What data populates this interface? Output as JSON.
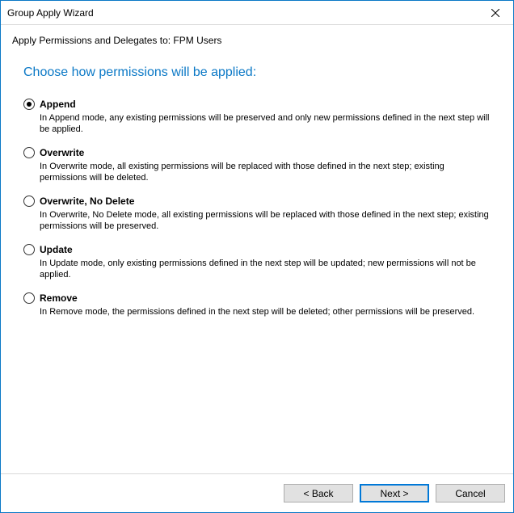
{
  "window": {
    "title": "Group Apply Wizard"
  },
  "subtitle": "Apply Permissions and Delegates to: FPM Users",
  "heading": "Choose how permissions will be applied:",
  "options": [
    {
      "label": "Append",
      "description": "In Append mode, any existing permissions will be preserved and only new permissions defined in the next step will be applied.",
      "checked": true
    },
    {
      "label": "Overwrite",
      "description": "In Overwrite mode, all existing permissions will be replaced with those defined in the next step; existing permissions will be deleted.",
      "checked": false
    },
    {
      "label": "Overwrite, No Delete",
      "description": "In Overwrite, No Delete mode, all existing permissions will be replaced with those defined in the next step; existing permissions will be preserved.",
      "checked": false
    },
    {
      "label": "Update",
      "description": "In Update mode, only existing permissions defined in the next step will be updated; new permissions will not be applied.",
      "checked": false
    },
    {
      "label": "Remove",
      "description": "In Remove mode, the permissions defined in the next step will be deleted; other permissions will be preserved.",
      "checked": false
    }
  ],
  "footer": {
    "back": "< Back",
    "next": "Next >",
    "cancel": "Cancel"
  }
}
